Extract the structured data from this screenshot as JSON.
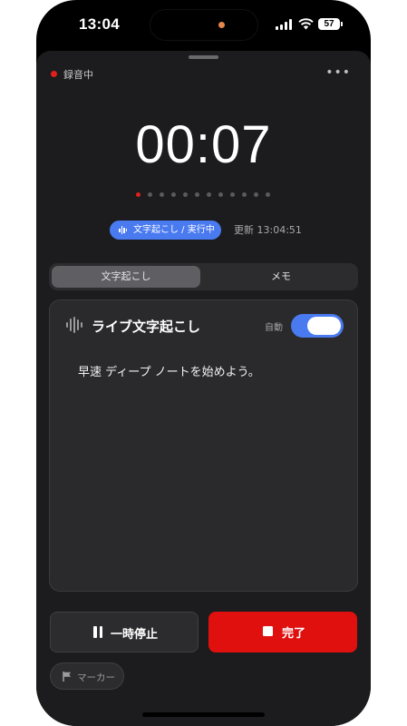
{
  "status_bar": {
    "time": "13:04",
    "battery": "57",
    "icons": [
      "cellular-signal-icon",
      "wifi-icon",
      "battery-icon"
    ]
  },
  "recorder": {
    "recording_label": "録音中",
    "more_icon": "ellipsis-icon",
    "timer": "00:07",
    "page_indicator": {
      "count": 12,
      "active": 1
    },
    "transcription_badge": "文字起こし / 実行中",
    "updated_text": "更新 13:04:51"
  },
  "tabs": [
    {
      "label": "文字起こし",
      "active": true
    },
    {
      "label": "メモ",
      "active": false
    }
  ],
  "transcript_card": {
    "title": "ライブ文字起こし",
    "auto_label": "自動",
    "auto_enabled": true,
    "text": "早速 ディープ ノートを始めよう。"
  },
  "controls": {
    "pause_label": "一時停止",
    "done_label": "完了",
    "marker_label": "マーカー"
  },
  "colors": {
    "accent_blue": "#4a7af0",
    "record_red": "#e0100f",
    "background": "#1c1c1e",
    "card": "#2a2a2c"
  }
}
